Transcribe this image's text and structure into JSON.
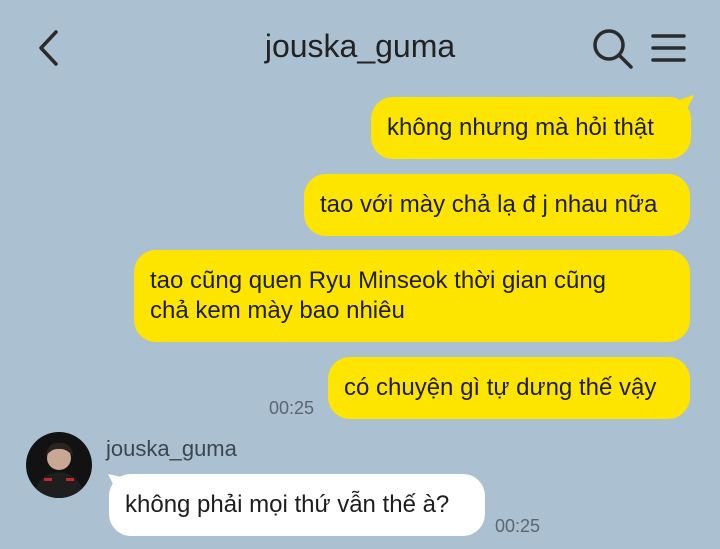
{
  "header": {
    "title": "jouska_guma",
    "back_icon": "chevron-left-icon",
    "search_icon": "search-icon",
    "menu_icon": "hamburger-menu-icon"
  },
  "colors": {
    "background": "#abc1d1",
    "outgoing_bubble": "#fee500",
    "incoming_bubble": "#ffffff"
  },
  "messages": [
    {
      "direction": "out",
      "text": "không nhưng mà hỏi thật"
    },
    {
      "direction": "out",
      "text": "tao với mày chả lạ đ j nhau nữa"
    },
    {
      "direction": "out",
      "line1": "tao cũng quen Ryu Minseok thời gian cũng",
      "line2": "chả kem mày bao nhiêu"
    },
    {
      "direction": "out",
      "text": "có chuyện gì tự dưng thế vậy",
      "time": "00:25"
    },
    {
      "direction": "in",
      "sender": "jouska_guma",
      "text": "không phải mọi thứ vẫn thế à?",
      "time": "00:25"
    }
  ]
}
